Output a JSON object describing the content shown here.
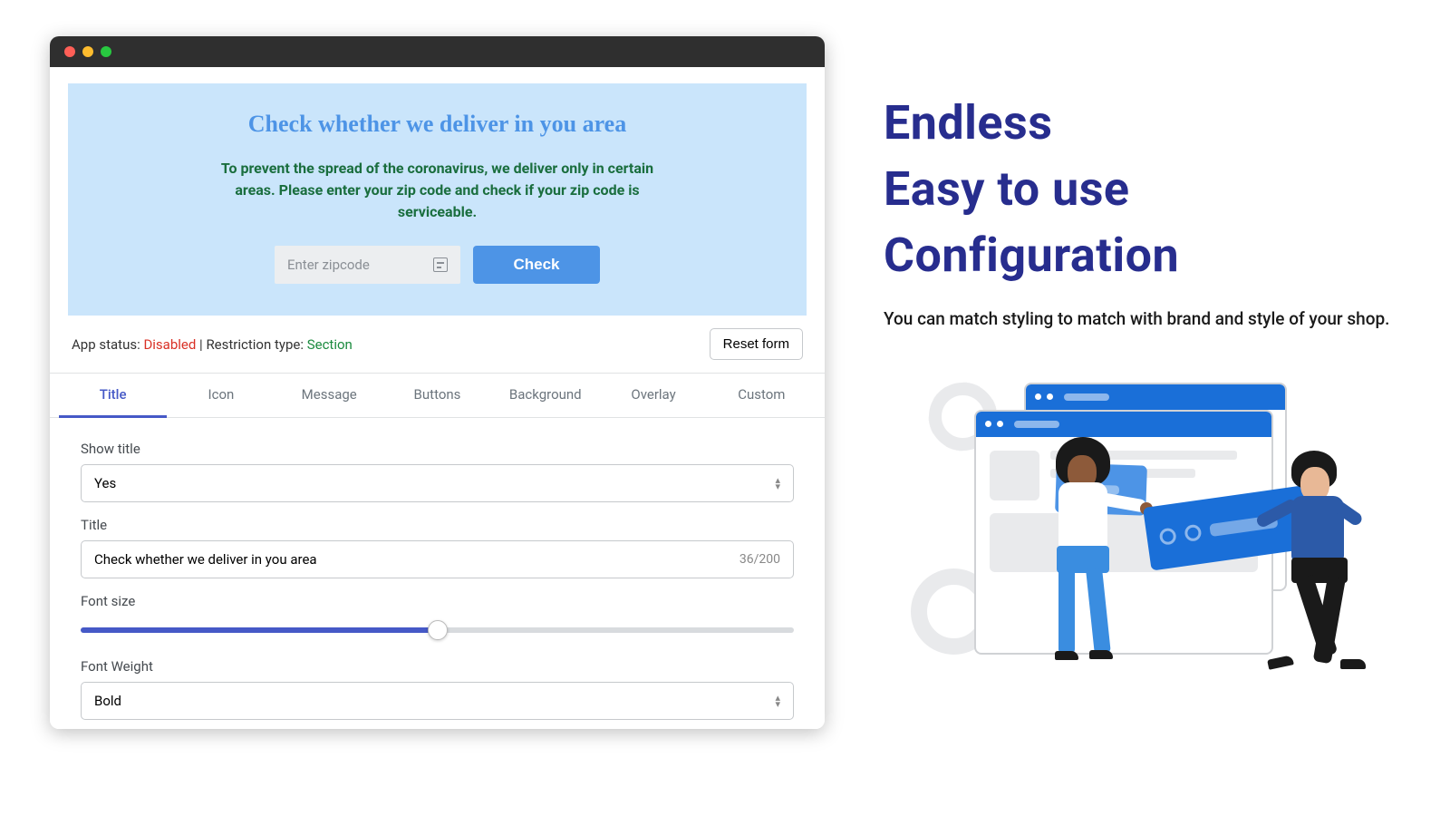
{
  "preview": {
    "title": "Check whether we deliver in you area",
    "message": "To prevent the spread of the coronavirus, we deliver only in certain areas. Please enter your zip code and check if your zip code is serviceable.",
    "placeholder": "Enter zipcode",
    "button": "Check"
  },
  "status": {
    "app_label": "App status: ",
    "app_value": "Disabled",
    "sep": " | ",
    "restriction_label": "Restriction type: ",
    "restriction_value": "Section",
    "reset": "Reset form"
  },
  "tabs": [
    "Title",
    "Icon",
    "Message",
    "Buttons",
    "Background",
    "Overlay",
    "Custom"
  ],
  "form": {
    "show_title_label": "Show title",
    "show_title_value": "Yes",
    "title_label": "Title",
    "title_value": "Check whether we deliver in you area",
    "title_counter": "36/200",
    "font_size_label": "Font size",
    "font_weight_label": "Font Weight",
    "font_weight_value": "Bold"
  },
  "promo": {
    "heading_line1": "Endless",
    "heading_line2": "Easy to use",
    "heading_line3": "Configuration",
    "description": "You can match styling to match with brand and style of your shop."
  }
}
